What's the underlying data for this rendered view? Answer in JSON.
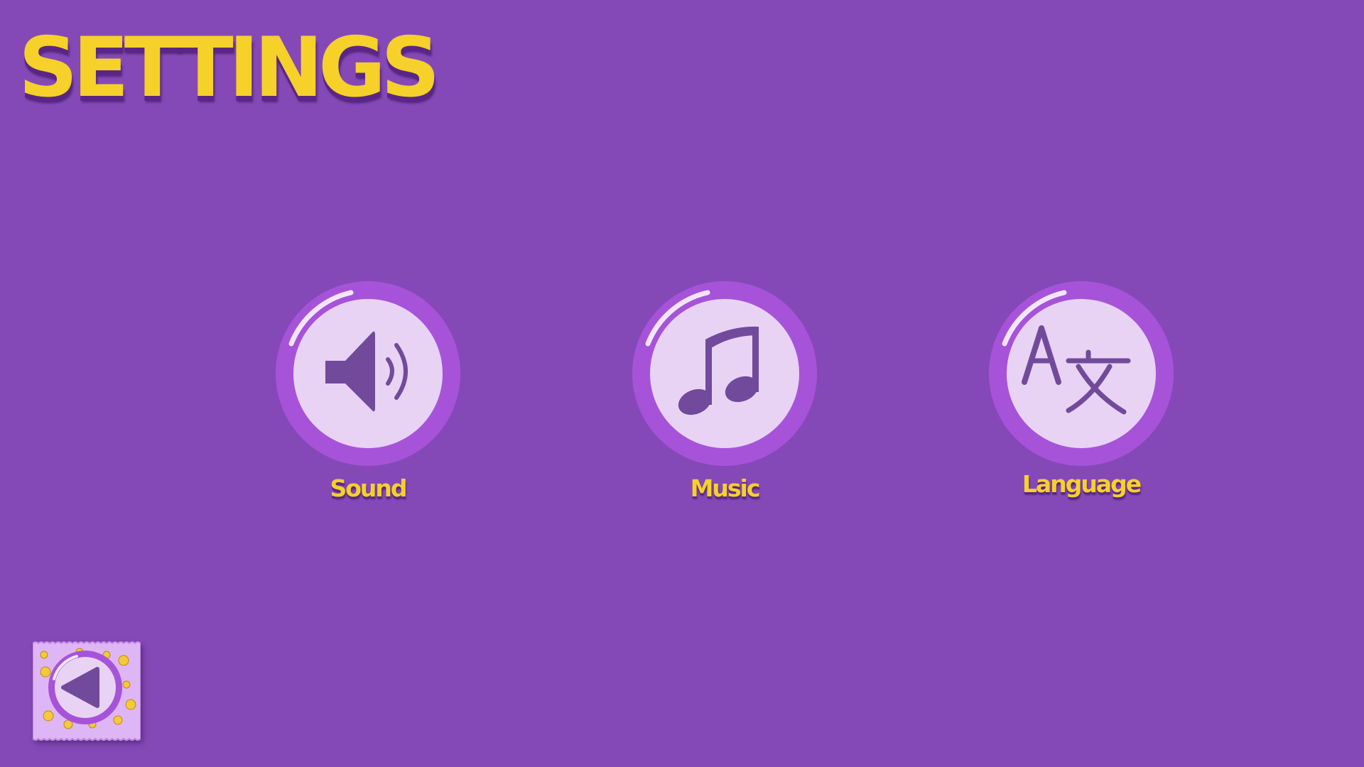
{
  "screen": {
    "title": "SETTINGS"
  },
  "options": [
    {
      "id": "sound",
      "label": "Sound",
      "icon": "speaker-icon"
    },
    {
      "id": "music",
      "label": "Music",
      "icon": "music-note-icon"
    },
    {
      "id": "language",
      "label": "Language",
      "icon": "translate-icon"
    }
  ],
  "back_button": {
    "icon": "back-arrow-icon"
  },
  "colors": {
    "background": "#8549b7",
    "title": "#f5d12a",
    "ring": "#a653da",
    "disc": "#e8d3f4",
    "glyph": "#724a9c",
    "shadow": "#5a2587"
  }
}
